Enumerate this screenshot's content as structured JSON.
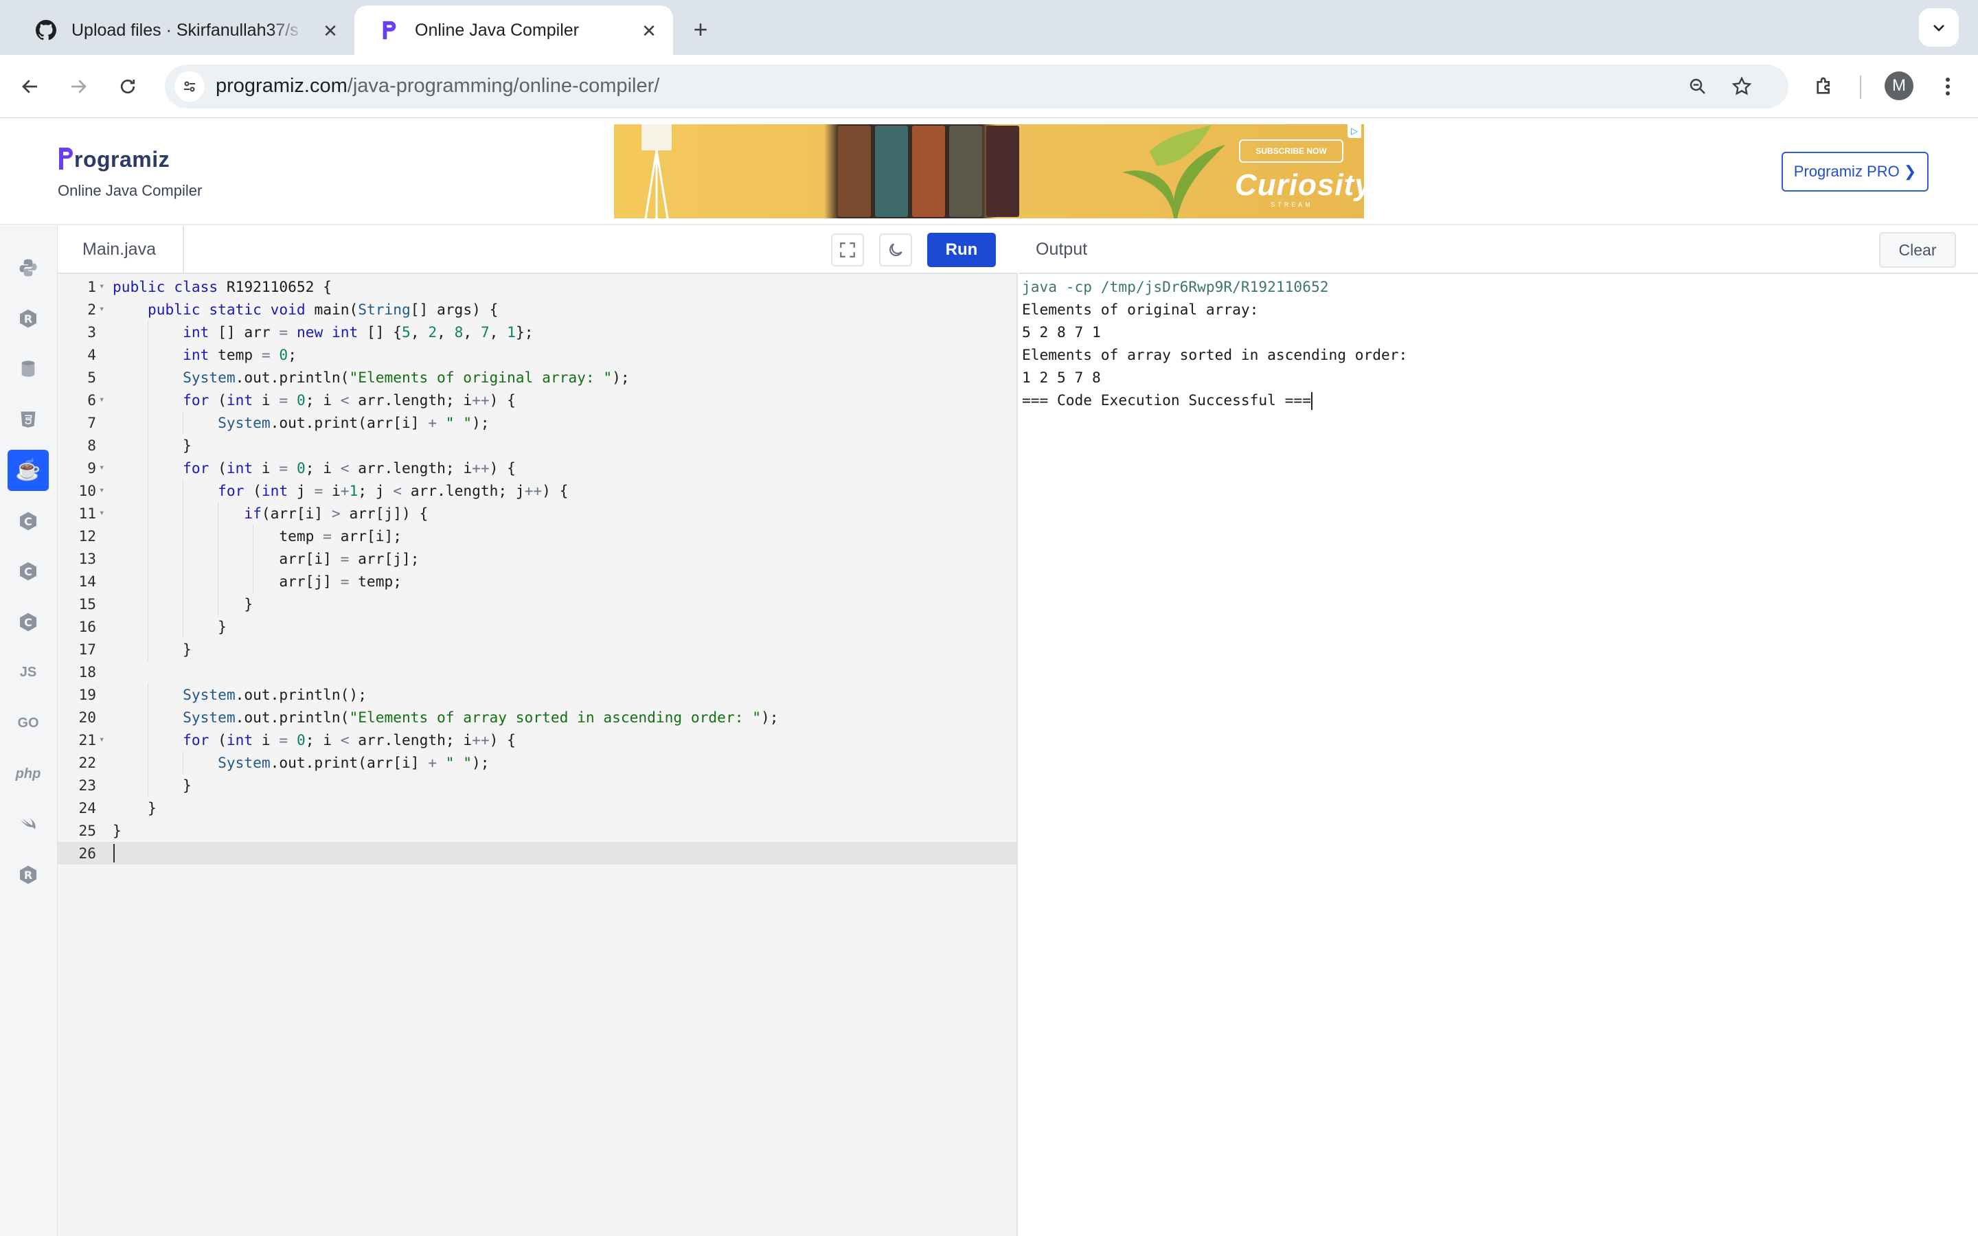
{
  "browser": {
    "tabs": [
      {
        "title": "Upload files · Skirfanullah37/s",
        "icon": "github-icon",
        "active": false
      },
      {
        "title": "Online Java Compiler",
        "icon": "programiz-icon",
        "active": true
      }
    ],
    "url_domain": "programiz.com",
    "url_path": "/java-programming/online-compiler/",
    "profile_initial": "M"
  },
  "site": {
    "logo_text": "rogramiz",
    "subtitle": "Online Java Compiler",
    "pro_button": "Programiz PRO ❯",
    "ad": {
      "subscribe": "SUBSCRIBE NOW",
      "brand": "Curiosity",
      "tagline": "STREAM"
    }
  },
  "languages": [
    {
      "name": "python-icon",
      "glyph": ""
    },
    {
      "name": "r-icon",
      "glyph": "R"
    },
    {
      "name": "sql-icon",
      "glyph": ""
    },
    {
      "name": "html-icon",
      "glyph": "5"
    },
    {
      "name": "java-icon",
      "glyph": "☕",
      "active": true
    },
    {
      "name": "c-icon",
      "glyph": "C"
    },
    {
      "name": "cpp-icon",
      "glyph": "C"
    },
    {
      "name": "csharp-icon",
      "glyph": "C"
    },
    {
      "name": "js-icon",
      "glyph": "JS"
    },
    {
      "name": "go-icon",
      "glyph": "GO"
    },
    {
      "name": "php-icon",
      "glyph": "php"
    },
    {
      "name": "swift-icon",
      "glyph": ""
    },
    {
      "name": "rust-icon",
      "glyph": "R"
    }
  ],
  "editor": {
    "file_name": "Main.java",
    "run_label": "Run",
    "lines": [
      "public class R192110652 {",
      "    public static void main(String[] args) {",
      "        int [] arr = new int [] {5, 2, 8, 7, 1};",
      "        int temp = 0;",
      "        System.out.println(\"Elements of original array: \");",
      "        for (int i = 0; i < arr.length; i++) {",
      "            System.out.print(arr[i] + \" \");",
      "        }",
      "        for (int i = 0; i < arr.length; i++) {",
      "            for (int j = i+1; j < arr.length; j++) {",
      "               if(arr[i] > arr[j]) {",
      "                   temp = arr[i];",
      "                   arr[i] = arr[j];",
      "                   arr[j] = temp;",
      "               }",
      "            }",
      "        }",
      "",
      "        System.out.println();",
      "        System.out.println(\"Elements of array sorted in ascending order: \");",
      "        for (int i = 0; i < arr.length; i++) {",
      "            System.out.print(arr[i] + \" \");",
      "        }",
      "    }",
      "}",
      ""
    ],
    "fold_lines": [
      1,
      2,
      6,
      9,
      10,
      11,
      21
    ],
    "current_line": 26
  },
  "output": {
    "label": "Output",
    "clear_label": "Clear",
    "lines": [
      "java -cp /tmp/jsDr6Rwp9R/R192110652",
      "Elements of original array: ",
      "5 2 8 7 1 ",
      "Elements of array sorted in ascending order: ",
      "1 2 5 7 8 ",
      "=== Code Execution Successful ==="
    ]
  }
}
